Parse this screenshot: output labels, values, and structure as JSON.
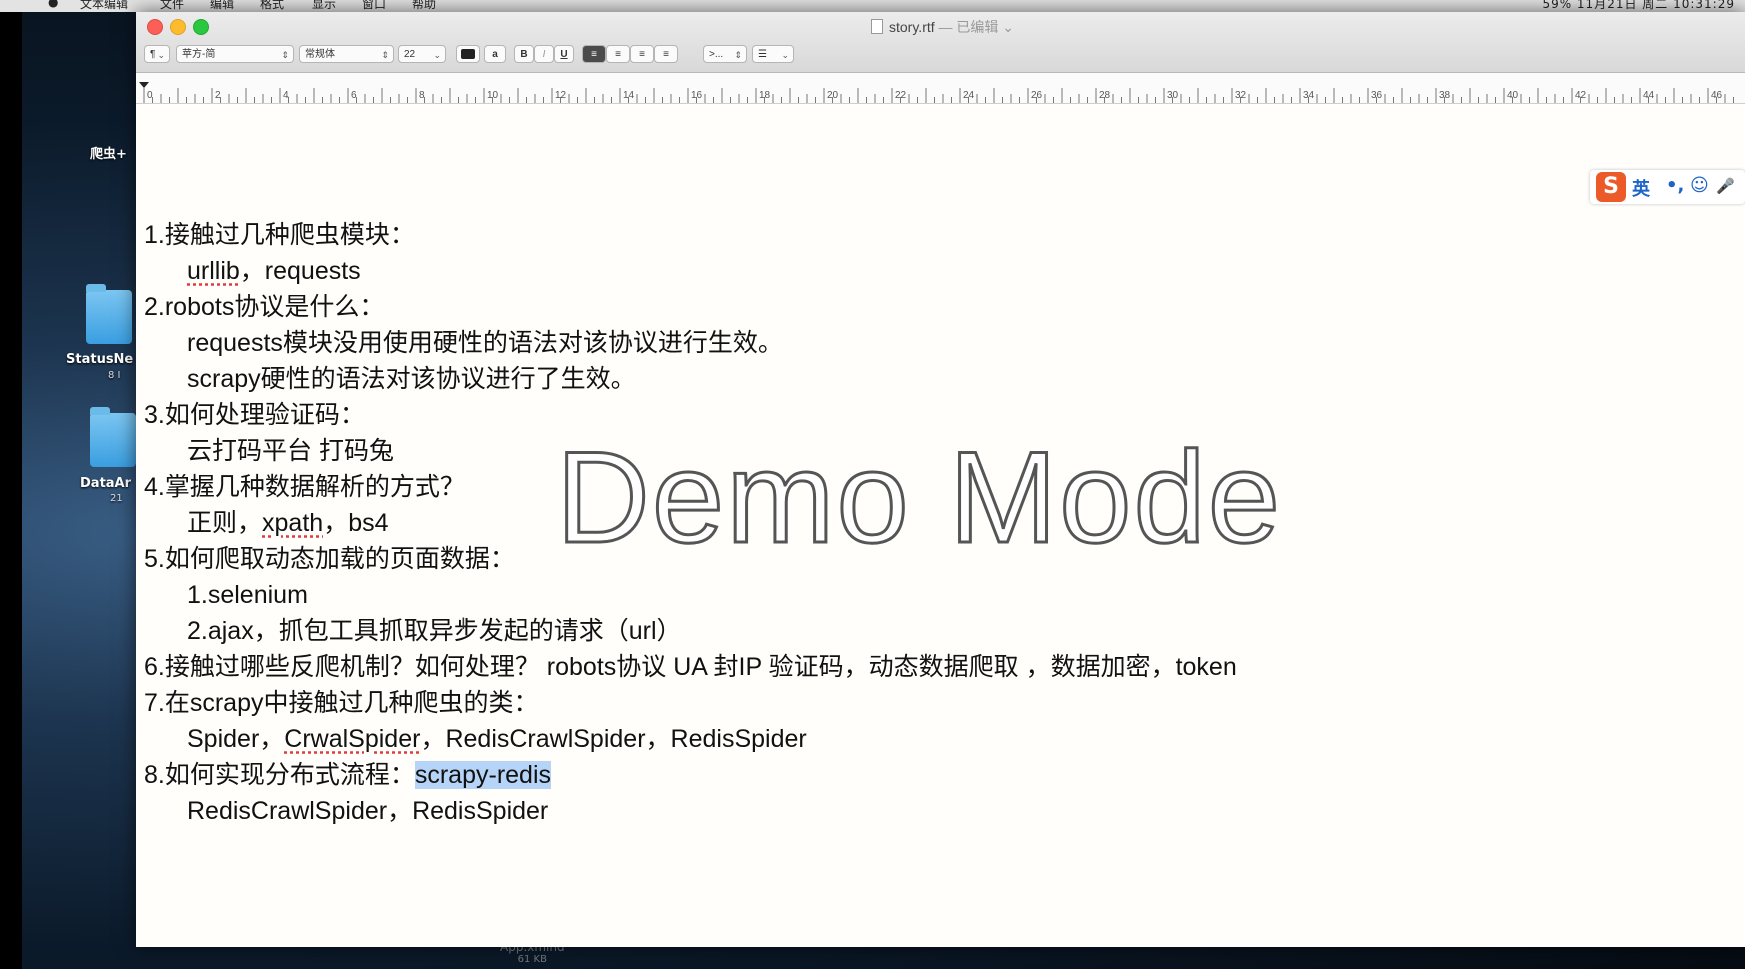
{
  "desktop": {
    "icon1_label": "爬虫+",
    "icon2_label": "StatusNe",
    "icon2_sub": "8 I",
    "icon3_label": "DataAr",
    "icon3_sub": "21",
    "bottom_file": "App.xmind",
    "bottom_size": "61 KB"
  },
  "menubar": {
    "items": [
      "文本编辑",
      "文件",
      "编辑",
      "格式",
      "显示",
      "窗口",
      "帮助"
    ],
    "status": "59%  11月21日 周二  10:31:29"
  },
  "window": {
    "title": "story.rtf",
    "edited": "— 已编辑 ⌄"
  },
  "toolbar": {
    "paragraph": "¶",
    "font_family": "苹方-简",
    "font_style": "常规体",
    "font_size": "22",
    "highlight": "a",
    "bold": "B",
    "italic": "I",
    "underline": "U",
    "spacing": ">...",
    "list": "☰"
  },
  "ruler": {
    "labels": [
      "0",
      "2",
      "4",
      "6",
      "8",
      "10",
      "12",
      "14",
      "16",
      "18",
      "20",
      "22",
      "24",
      "26",
      "28",
      "30",
      "32",
      "34",
      "36",
      "38",
      "40",
      "42",
      "44",
      "46"
    ]
  },
  "document": {
    "l1": "1.接触过几种爬虫模块：",
    "l2a": "urllib",
    "l2b": "，requests",
    "l3": "2.robots协议是什么：",
    "l4": "requests模块没用使用硬性的语法对该协议进行生效。",
    "l5": "scrapy硬性的语法对该协议进行了生效。",
    "l6": "3.如何处理验证码：",
    "l7": "云打码平台  打码兔",
    "l8": "4.掌握几种数据解析的方式？",
    "l9a": "正则，",
    "l9b": "xpath",
    "l9c": "，bs4",
    "l10": "5.如何爬取动态加载的页面数据：",
    "l11": "1.selenium",
    "l12": "2.ajax，抓包工具抓取异步发起的请求（url）",
    "l13": "6.接触过哪些反爬机制？如何处理？ robots协议  UA  封IP  验证码，动态数据爬取 ，数据加密，token",
    "l14": "7.在scrapy中接触过几种爬虫的类：",
    "l15a": "Spider，",
    "l15b": "CrwalSpider",
    "l15c": "，RedisCrawlSpider，RedisSpider",
    "l16a": "8.如何实现分布式流程：",
    "l16b": "scrapy-redis",
    "l17": "RedisCrawlSpider，RedisSpider"
  },
  "watermark": "Demo Mode",
  "ime": {
    "logo": "S",
    "lang": "英",
    "punct": "•,",
    "emoji": "☺",
    "mic": "🎤"
  },
  "colors": {
    "selection": "#b5d4f7",
    "close": "#fc5f57",
    "minimize": "#fdbc2e",
    "zoom": "#29c840"
  }
}
